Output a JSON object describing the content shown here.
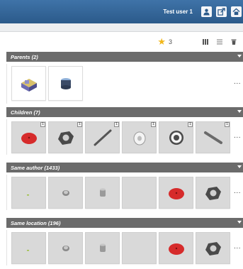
{
  "header": {
    "user_name": "Test user 1",
    "icons": [
      "user-icon",
      "share-icon",
      "home-icon"
    ]
  },
  "toolbar": {
    "favorite_count": "3",
    "icons": [
      "star-icon",
      "grid-view-icon",
      "list-view-icon",
      "delete-icon"
    ]
  },
  "sections": {
    "parents": {
      "title": "Parents (2)"
    },
    "children": {
      "title": "Children (7)"
    },
    "same_author": {
      "title": "Same author (1433)"
    },
    "same_location": {
      "title": "Same location (196)"
    }
  },
  "more_label": "...",
  "child_badge": "1",
  "colors": {
    "header_bg": "#2f6296",
    "section_bg": "#6b6b6b",
    "accent_red": "#d62b2b",
    "star": "#f2b71a"
  }
}
